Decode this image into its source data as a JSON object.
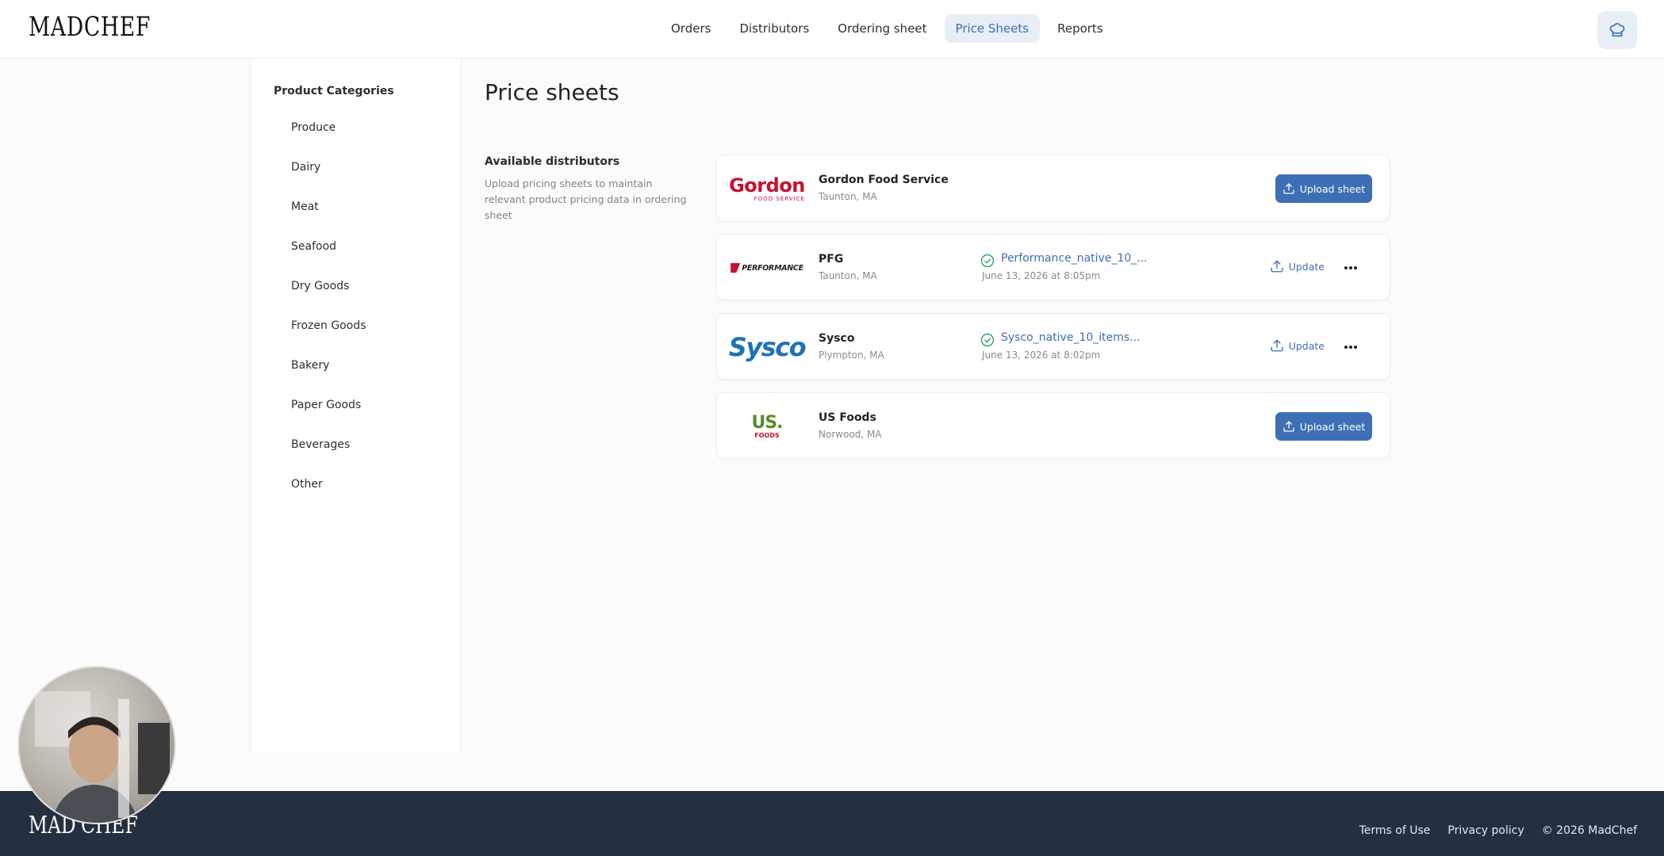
{
  "app": {
    "logo": "MADCHEF"
  },
  "nav": {
    "items": [
      {
        "label": "Orders",
        "active": false
      },
      {
        "label": "Distributors",
        "active": false
      },
      {
        "label": "Ordering sheet",
        "active": false
      },
      {
        "label": "Price Sheets",
        "active": true
      },
      {
        "label": "Reports",
        "active": false
      }
    ],
    "profile_icon": "chef-hat-icon"
  },
  "sidebar": {
    "title": "Product Categories",
    "items": [
      "Produce",
      "Dairy",
      "Meat",
      "Seafood",
      "Dry Goods",
      "Frozen Goods",
      "Bakery",
      "Paper Goods",
      "Beverages",
      "Other"
    ]
  },
  "main": {
    "title": "Price sheets",
    "available_title": "Available distributors",
    "available_desc": "Upload pricing sheets to maintain relevant product pricing data in ordering sheet",
    "distributors": [
      {
        "name": "Gordon Food Service",
        "location": "Taunton, MA",
        "logo_text": "Gordon",
        "logo_sub": "FOOD SERVICE",
        "action": "Upload sheet"
      },
      {
        "name": "PFG",
        "location": "Taunton, MA",
        "logo_text": "PERFORMANCE",
        "file": "Performance_native_10_...",
        "date": "June 13, 2026 at 8:05pm",
        "action": "Update"
      },
      {
        "name": "Sysco",
        "location": "Plympton, MA",
        "logo_text": "Sysco",
        "file": "Sysco_native_10_items...",
        "date": "June 13, 2026 at 8:02pm",
        "action": "Update"
      },
      {
        "name": "US Foods",
        "location": "Norwood, MA",
        "logo_text": "US.",
        "logo_sub": "FOODS",
        "action": "Upload sheet"
      }
    ]
  },
  "footer": {
    "logo": "MAD'CHEF",
    "links": [
      "Terms of Use",
      "Privacy policy",
      "© 2026 MadChef"
    ]
  },
  "colors": {
    "accent": "#3d6fb6",
    "footer_bg": "#24303f",
    "success": "#3aa76d",
    "gordon_red": "#c8102e",
    "sysco_blue": "#1f72b8",
    "usfoods_green": "#5a8a2a"
  }
}
